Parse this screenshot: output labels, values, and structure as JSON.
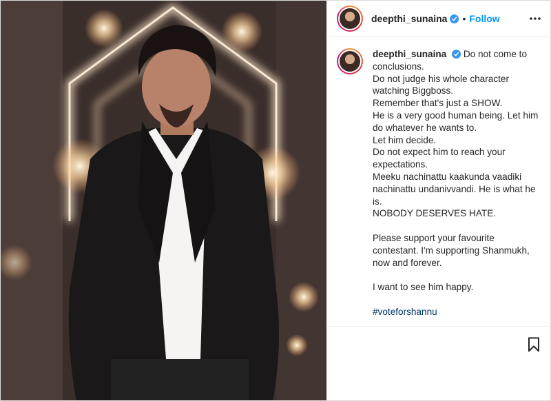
{
  "post": {
    "username": "deepthi_sunaina",
    "follow_label": "Follow",
    "dot": "•",
    "caption_lines": [
      "Do not come to conclusions.",
      "Do not judge his whole character watching Biggboss.",
      "Remember that's just a SHOW.",
      "He is a very good human being. Let him do whatever he wants to.",
      "Let him decide.",
      "Do not expect him to reach your expectations.",
      "Meeku nachinattu kaakunda vaadiki nachinattu undanivvandi. He is what he is.",
      "NOBODY DESERVES HATE.",
      "",
      "Please support your favourite contestant. I'm supporting Shanmukh, now and forever.",
      "",
      "I want to see him happy.",
      ""
    ],
    "hashtag": "#voteforshannu"
  },
  "icons": {
    "verified": "verified-badge-icon",
    "more": "more-options-icon",
    "bookmark": "bookmark-icon"
  },
  "colors": {
    "link_blue": "#0095f6",
    "hashtag": "#00376b"
  }
}
